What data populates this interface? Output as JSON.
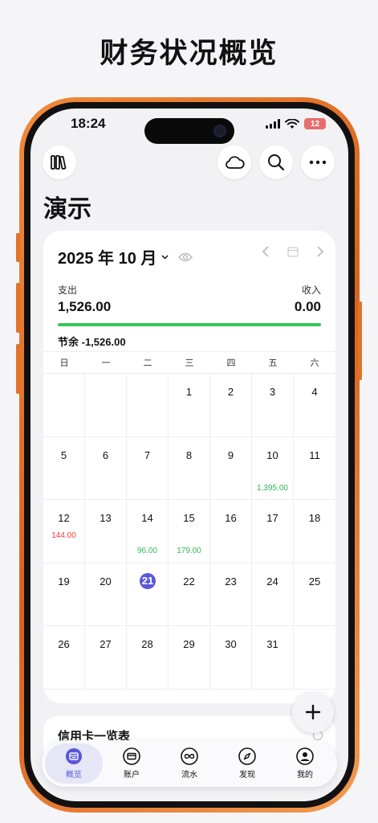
{
  "headline": "财务状况概览",
  "status_bar": {
    "time": "18:24",
    "battery": "12"
  },
  "page_title": "演示",
  "calendar_card": {
    "month_label": "2025 年 10 月",
    "expense_label": "支出",
    "expense_value": "1,526.00",
    "income_label": "收入",
    "income_value": "0.00",
    "progress_fraction": 1.0,
    "balance": "节余 -1,526.00",
    "weekdays": [
      "日",
      "一",
      "二",
      "三",
      "四",
      "五",
      "六"
    ],
    "days": [
      {
        "d": "",
        "amt": "",
        "kind": ""
      },
      {
        "d": "",
        "amt": "",
        "kind": ""
      },
      {
        "d": "",
        "amt": "",
        "kind": ""
      },
      {
        "d": "1",
        "amt": "",
        "kind": ""
      },
      {
        "d": "2",
        "amt": "",
        "kind": ""
      },
      {
        "d": "3",
        "amt": "",
        "kind": ""
      },
      {
        "d": "4",
        "amt": "",
        "kind": ""
      },
      {
        "d": "5",
        "amt": "",
        "kind": ""
      },
      {
        "d": "6",
        "amt": "",
        "kind": ""
      },
      {
        "d": "7",
        "amt": "",
        "kind": ""
      },
      {
        "d": "8",
        "amt": "",
        "kind": ""
      },
      {
        "d": "9",
        "amt": "",
        "kind": ""
      },
      {
        "d": "10",
        "amt": "1,395.00",
        "kind": "green"
      },
      {
        "d": "11",
        "amt": "",
        "kind": ""
      },
      {
        "d": "12",
        "amt": "144.00",
        "kind": "red"
      },
      {
        "d": "13",
        "amt": "",
        "kind": ""
      },
      {
        "d": "14",
        "amt": "96.00",
        "kind": "green"
      },
      {
        "d": "15",
        "amt": "179.00",
        "kind": "green"
      },
      {
        "d": "16",
        "amt": "",
        "kind": ""
      },
      {
        "d": "17",
        "amt": "",
        "kind": ""
      },
      {
        "d": "18",
        "amt": "",
        "kind": ""
      },
      {
        "d": "19",
        "amt": "",
        "kind": ""
      },
      {
        "d": "20",
        "amt": "",
        "kind": ""
      },
      {
        "d": "21",
        "amt": "",
        "kind": "today"
      },
      {
        "d": "22",
        "amt": "",
        "kind": ""
      },
      {
        "d": "23",
        "amt": "",
        "kind": ""
      },
      {
        "d": "24",
        "amt": "",
        "kind": ""
      },
      {
        "d": "25",
        "amt": "",
        "kind": ""
      },
      {
        "d": "26",
        "amt": "",
        "kind": ""
      },
      {
        "d": "27",
        "amt": "",
        "kind": ""
      },
      {
        "d": "28",
        "amt": "",
        "kind": ""
      },
      {
        "d": "29",
        "amt": "",
        "kind": ""
      },
      {
        "d": "30",
        "amt": "",
        "kind": ""
      },
      {
        "d": "31",
        "amt": "",
        "kind": ""
      },
      {
        "d": "",
        "amt": "",
        "kind": ""
      }
    ]
  },
  "credit_card_title": "信用卡一览表",
  "tabs": [
    {
      "label": "概览",
      "icon": "overview-icon",
      "active": true
    },
    {
      "label": "账户",
      "icon": "account-card-icon",
      "active": false
    },
    {
      "label": "流水",
      "icon": "infinity-icon",
      "active": false
    },
    {
      "label": "发现",
      "icon": "compass-icon",
      "active": false
    },
    {
      "label": "我的",
      "icon": "profile-icon",
      "active": false
    }
  ],
  "colors": {
    "accent": "#5a57d9",
    "income_green": "#2fbd4e",
    "expense_red": "#ef3a3a",
    "frame_orange": "#e8742a"
  }
}
